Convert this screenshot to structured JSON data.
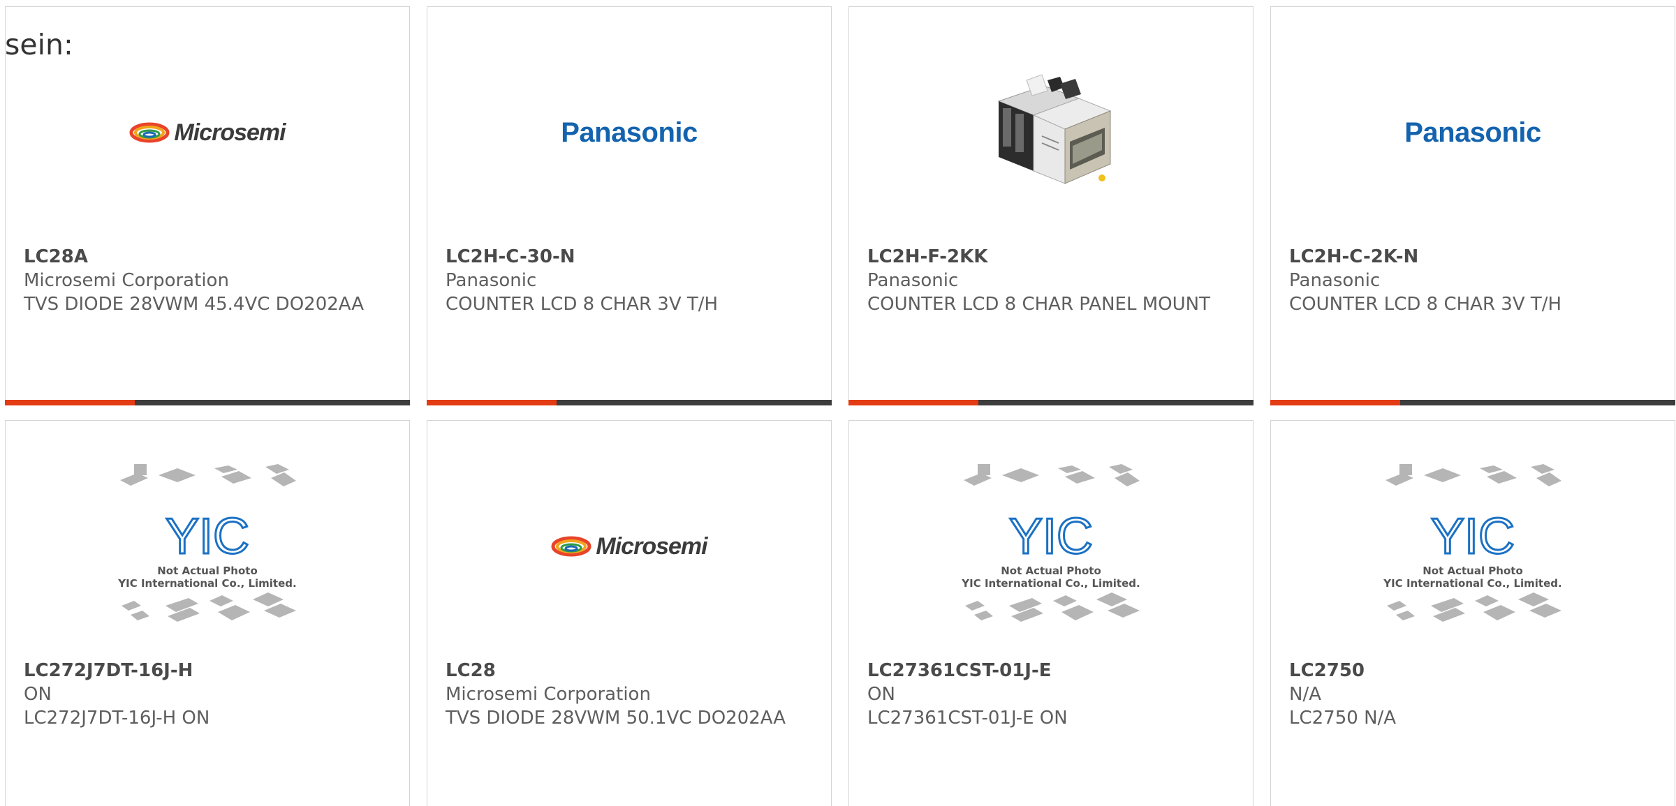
{
  "page": {
    "fragment_text": "sein:"
  },
  "products": [
    {
      "part_number": "LC28A",
      "manufacturer": "Microsemi Corporation",
      "description": "TVS DIODE 28VWM 45.4VC DO202AA",
      "image": "microsemi-logo",
      "logo_text": "Microsemi",
      "progress": 0.32
    },
    {
      "part_number": "LC2H-C-30-N",
      "manufacturer": "Panasonic",
      "description": "COUNTER LCD 8 CHAR 3V T/H",
      "image": "panasonic-logo",
      "logo_text": "Panasonic",
      "progress": 0.32
    },
    {
      "part_number": "LC2H-F-2KK",
      "manufacturer": "Panasonic",
      "description": "COUNTER LCD 8 CHAR PANEL MOUNT",
      "image": "product-photo-lcd-counter",
      "progress": 0.32
    },
    {
      "part_number": "LC2H-C-2K-N",
      "manufacturer": "Panasonic",
      "description": "COUNTER LCD 8 CHAR 3V T/H",
      "image": "panasonic-logo",
      "logo_text": "Panasonic",
      "progress": 0.32
    },
    {
      "part_number": "LC272J7DT-16J-H",
      "manufacturer": "ON",
      "description": "LC272J7DT-16J-H ON",
      "image": "yic-placeholder",
      "placeholder_lines": [
        "Not Actual Photo",
        "YIC International Co., Limited."
      ]
    },
    {
      "part_number": "LC28",
      "manufacturer": "Microsemi Corporation",
      "description": "TVS DIODE 28VWM 50.1VC DO202AA",
      "image": "microsemi-logo",
      "logo_text": "Microsemi"
    },
    {
      "part_number": "LC27361CST-01J-E",
      "manufacturer": "ON",
      "description": "LC27361CST-01J-E ON",
      "image": "yic-placeholder",
      "placeholder_lines": [
        "Not Actual Photo",
        "YIC International Co., Limited."
      ]
    },
    {
      "part_number": "LC2750",
      "manufacturer": "N/A",
      "description": "LC2750 N/A",
      "image": "yic-placeholder",
      "placeholder_lines": [
        "Not Actual Photo",
        "YIC International Co., Limited."
      ]
    }
  ],
  "colors": {
    "progress_fill": "#e33b13",
    "progress_track": "#3d3d3d",
    "panasonic_blue": "#1463ae",
    "yic_blue": "#1b71c4"
  }
}
